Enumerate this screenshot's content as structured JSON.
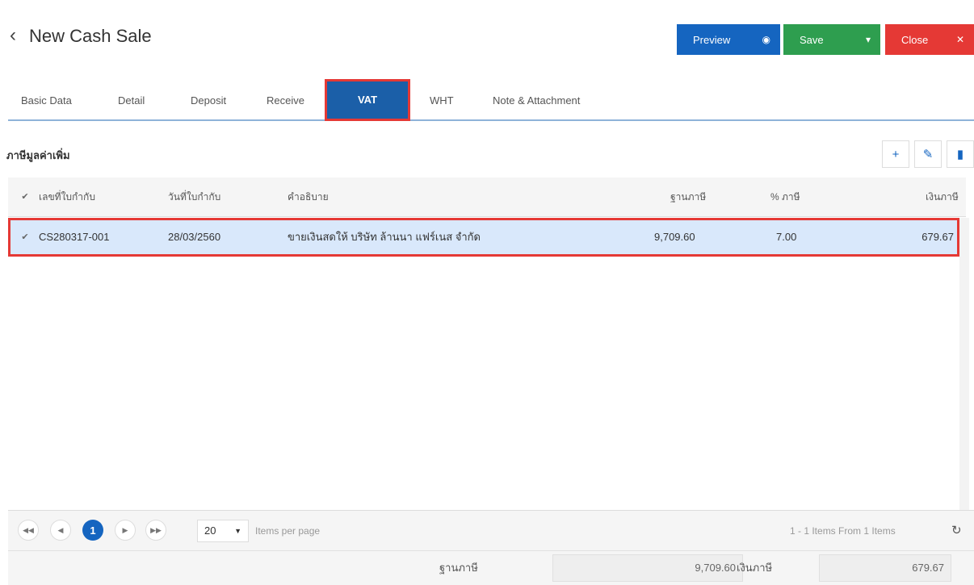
{
  "header": {
    "title": "New Cash Sale",
    "preview_label": "Preview",
    "save_label": "Save",
    "close_label": "Close"
  },
  "tabs": [
    {
      "label": "Basic Data",
      "active": false
    },
    {
      "label": "Detail",
      "active": false
    },
    {
      "label": "Deposit",
      "active": false
    },
    {
      "label": "Receive",
      "active": false
    },
    {
      "label": "VAT",
      "active": true
    },
    {
      "label": "WHT",
      "active": false
    },
    {
      "label": "Note & Attachment",
      "active": false
    }
  ],
  "section": {
    "title": "ภาษีมูลค่าเพิ่ม"
  },
  "table": {
    "columns": [
      "เลขที่ใบกำกับ",
      "วันที่ใบกำกับ",
      "คำอธิบาย",
      "ฐานภาษี",
      "% ภาษี",
      "เงินภาษี"
    ],
    "rows": [
      {
        "invoice_no": "CS280317-001",
        "date": "28/03/2560",
        "description": "ขายเงินสดให้ บริษัท ล้านนา แฟร์เนส จำกัด",
        "tax_base": "9,709.60",
        "tax_pct": "7.00",
        "tax_amount": "679.67",
        "checked": true
      }
    ]
  },
  "pager": {
    "current_page": "1",
    "page_size": "20",
    "items_per_page_label": "Items per page",
    "summary": "1 - 1 Items From 1 Items"
  },
  "footer": {
    "tax_base_label": "ฐานภาษี",
    "tax_base_value": "9,709.60",
    "tax_amount_label": "เงินภาษี",
    "tax_amount_value": "679.67"
  },
  "colors": {
    "primary": "#1565c0",
    "save": "#2e9e4f",
    "close": "#e53935",
    "highlight": "#e53935",
    "row_selected": "#d9e8fb"
  }
}
